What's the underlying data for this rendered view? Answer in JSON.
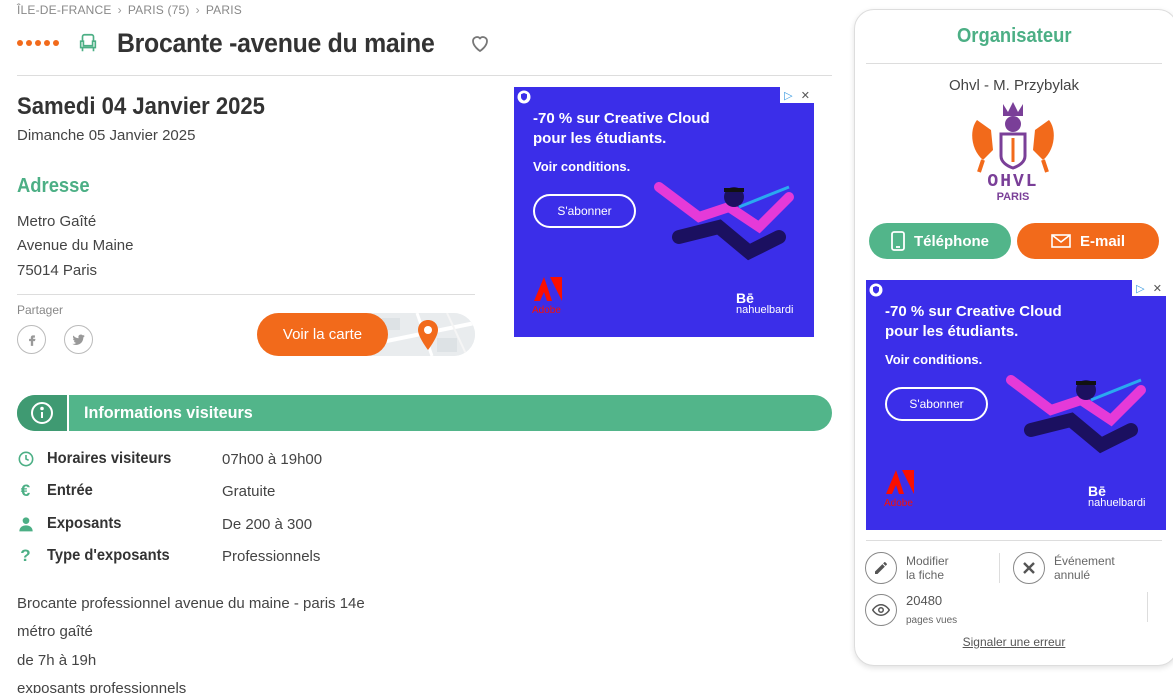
{
  "breadcrumb": [
    "ÎLE-DE-FRANCE",
    "PARIS (75)",
    "PARIS"
  ],
  "event": {
    "title": "Brocante -avenue du maine",
    "date_main": "Samedi 04 Janvier 2025",
    "date_sub": "Dimanche 05 Janvier 2025"
  },
  "address": {
    "title": "Adresse",
    "lines": [
      "Metro Gaîté",
      "Avenue du Maine",
      "75014 Paris"
    ]
  },
  "share": {
    "label": "Partager"
  },
  "map": {
    "button_label": "Voir la carte"
  },
  "ad": {
    "headline_1": "-70 % sur Creative Cloud",
    "headline_2": "pour les étudiants.",
    "conditions": "Voir conditions.",
    "cta": "S'abonner",
    "brand": "Adobe",
    "behance_mark": "Bē",
    "behance_user": "nahuelbardi"
  },
  "info": {
    "title": "Informations visiteurs",
    "rows": [
      {
        "label": "Horaires visiteurs",
        "value": "07h00 à 19h00",
        "icon": "clock-icon"
      },
      {
        "label": "Entrée",
        "value": "Gratuite",
        "icon": "euro-icon"
      },
      {
        "label": "Exposants",
        "value": "De 200 à 300",
        "icon": "person-icon"
      },
      {
        "label": "Type d'exposants",
        "value": "Professionnels",
        "icon": "question-icon"
      }
    ]
  },
  "description": [
    "Brocante professionnel avenue du maine - paris 14e",
    "métro gaîté",
    "de 7h à 19h",
    "exposants professionnels"
  ],
  "organizer": {
    "title": "Organisateur",
    "name": "Ohvl - M. Przybylak",
    "logo_text_1": "OHVL",
    "logo_text_2": "PARIS",
    "phone_label": "Téléphone",
    "email_label": "E-mail"
  },
  "sidebar_actions": {
    "edit_1": "Modifier",
    "edit_2": "la fiche",
    "cancel_1": "Événement",
    "cancel_2": "annulé",
    "views_count": "20480",
    "views_unit": "pages vues",
    "report": "Signaler une erreur"
  },
  "colors": {
    "accent_green": "#4caf85",
    "accent_orange": "#f26a1b",
    "ad_blue": "#3b2ee9"
  }
}
